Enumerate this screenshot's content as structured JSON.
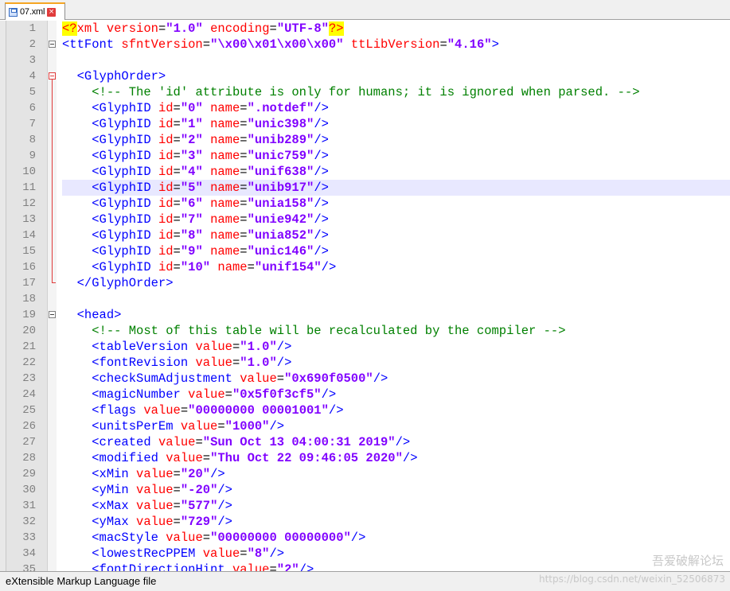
{
  "tab": {
    "label": "07.xml",
    "close": "×"
  },
  "status": {
    "file_type": "eXtensible Markup Language file"
  },
  "watermark": {
    "site": "吾爱破解论坛",
    "url": "https://blog.csdn.net/weixin_52506873"
  },
  "current_line": 11,
  "lines": [
    {
      "n": "1",
      "fold": "none",
      "parts": [
        [
          "pi",
          "<?"
        ],
        [
          "pibody",
          "xml "
        ],
        [
          "attr",
          "version"
        ],
        [
          "plain",
          "="
        ],
        [
          "val",
          "\"1.0\""
        ],
        [
          "plain",
          " "
        ],
        [
          "attr",
          "encoding"
        ],
        [
          "plain",
          "="
        ],
        [
          "val",
          "\"UTF-8\""
        ],
        [
          "pi",
          "?>"
        ]
      ]
    },
    {
      "n": "2",
      "fold": "open-grey",
      "parts": [
        [
          "tag",
          "<ttFont "
        ],
        [
          "attr",
          "sfntVersion"
        ],
        [
          "plain",
          "="
        ],
        [
          "val",
          "\"\\x00\\x01\\x00\\x00\""
        ],
        [
          "plain",
          " "
        ],
        [
          "attr",
          "ttLibVersion"
        ],
        [
          "plain",
          "="
        ],
        [
          "val",
          "\"4.16\""
        ],
        [
          "tag",
          ">"
        ]
      ]
    },
    {
      "n": "3",
      "fold": "none",
      "parts": []
    },
    {
      "n": "4",
      "fold": "open-red",
      "parts": [
        [
          "plain",
          "  "
        ],
        [
          "tag",
          "<GlyphOrder>"
        ]
      ]
    },
    {
      "n": "5",
      "fold": "line",
      "parts": [
        [
          "plain",
          "    "
        ],
        [
          "com",
          "<!-- The 'id' attribute is only for humans; it is ignored when parsed. -->"
        ]
      ]
    },
    {
      "n": "6",
      "fold": "line",
      "parts": [
        [
          "plain",
          "    "
        ],
        [
          "tag",
          "<GlyphID "
        ],
        [
          "attr",
          "id"
        ],
        [
          "plain",
          "="
        ],
        [
          "val",
          "\"0\""
        ],
        [
          "plain",
          " "
        ],
        [
          "attr",
          "name"
        ],
        [
          "plain",
          "="
        ],
        [
          "val",
          "\".notdef\""
        ],
        [
          "tag",
          "/>"
        ]
      ]
    },
    {
      "n": "7",
      "fold": "line",
      "parts": [
        [
          "plain",
          "    "
        ],
        [
          "tag",
          "<GlyphID "
        ],
        [
          "attr",
          "id"
        ],
        [
          "plain",
          "="
        ],
        [
          "val",
          "\"1\""
        ],
        [
          "plain",
          " "
        ],
        [
          "attr",
          "name"
        ],
        [
          "plain",
          "="
        ],
        [
          "val",
          "\"unic398\""
        ],
        [
          "tag",
          "/>"
        ]
      ]
    },
    {
      "n": "8",
      "fold": "line",
      "parts": [
        [
          "plain",
          "    "
        ],
        [
          "tag",
          "<GlyphID "
        ],
        [
          "attr",
          "id"
        ],
        [
          "plain",
          "="
        ],
        [
          "val",
          "\"2\""
        ],
        [
          "plain",
          " "
        ],
        [
          "attr",
          "name"
        ],
        [
          "plain",
          "="
        ],
        [
          "val",
          "\"unib289\""
        ],
        [
          "tag",
          "/>"
        ]
      ]
    },
    {
      "n": "9",
      "fold": "line",
      "parts": [
        [
          "plain",
          "    "
        ],
        [
          "tag",
          "<GlyphID "
        ],
        [
          "attr",
          "id"
        ],
        [
          "plain",
          "="
        ],
        [
          "val",
          "\"3\""
        ],
        [
          "plain",
          " "
        ],
        [
          "attr",
          "name"
        ],
        [
          "plain",
          "="
        ],
        [
          "val",
          "\"unic759\""
        ],
        [
          "tag",
          "/>"
        ]
      ]
    },
    {
      "n": "10",
      "fold": "line",
      "parts": [
        [
          "plain",
          "    "
        ],
        [
          "tag",
          "<GlyphID "
        ],
        [
          "attr",
          "id"
        ],
        [
          "plain",
          "="
        ],
        [
          "val",
          "\"4\""
        ],
        [
          "plain",
          " "
        ],
        [
          "attr",
          "name"
        ],
        [
          "plain",
          "="
        ],
        [
          "val",
          "\"unif638\""
        ],
        [
          "tag",
          "/>"
        ]
      ]
    },
    {
      "n": "11",
      "fold": "line",
      "parts": [
        [
          "plain",
          "    "
        ],
        [
          "tag",
          "<GlyphID "
        ],
        [
          "attr",
          "id"
        ],
        [
          "plain",
          "="
        ],
        [
          "val",
          "\"5\""
        ],
        [
          "plain",
          " "
        ],
        [
          "attr",
          "name"
        ],
        [
          "plain",
          "="
        ],
        [
          "val",
          "\"unib917\""
        ],
        [
          "tag",
          "/>"
        ]
      ]
    },
    {
      "n": "12",
      "fold": "line",
      "parts": [
        [
          "plain",
          "    "
        ],
        [
          "tag",
          "<GlyphID "
        ],
        [
          "attr",
          "id"
        ],
        [
          "plain",
          "="
        ],
        [
          "val",
          "\"6\""
        ],
        [
          "plain",
          " "
        ],
        [
          "attr",
          "name"
        ],
        [
          "plain",
          "="
        ],
        [
          "val",
          "\"unia158\""
        ],
        [
          "tag",
          "/>"
        ]
      ]
    },
    {
      "n": "13",
      "fold": "line",
      "parts": [
        [
          "plain",
          "    "
        ],
        [
          "tag",
          "<GlyphID "
        ],
        [
          "attr",
          "id"
        ],
        [
          "plain",
          "="
        ],
        [
          "val",
          "\"7\""
        ],
        [
          "plain",
          " "
        ],
        [
          "attr",
          "name"
        ],
        [
          "plain",
          "="
        ],
        [
          "val",
          "\"unie942\""
        ],
        [
          "tag",
          "/>"
        ]
      ]
    },
    {
      "n": "14",
      "fold": "line",
      "parts": [
        [
          "plain",
          "    "
        ],
        [
          "tag",
          "<GlyphID "
        ],
        [
          "attr",
          "id"
        ],
        [
          "plain",
          "="
        ],
        [
          "val",
          "\"8\""
        ],
        [
          "plain",
          " "
        ],
        [
          "attr",
          "name"
        ],
        [
          "plain",
          "="
        ],
        [
          "val",
          "\"unia852\""
        ],
        [
          "tag",
          "/>"
        ]
      ]
    },
    {
      "n": "15",
      "fold": "line",
      "parts": [
        [
          "plain",
          "    "
        ],
        [
          "tag",
          "<GlyphID "
        ],
        [
          "attr",
          "id"
        ],
        [
          "plain",
          "="
        ],
        [
          "val",
          "\"9\""
        ],
        [
          "plain",
          " "
        ],
        [
          "attr",
          "name"
        ],
        [
          "plain",
          "="
        ],
        [
          "val",
          "\"unic146\""
        ],
        [
          "tag",
          "/>"
        ]
      ]
    },
    {
      "n": "16",
      "fold": "line",
      "parts": [
        [
          "plain",
          "    "
        ],
        [
          "tag",
          "<GlyphID "
        ],
        [
          "attr",
          "id"
        ],
        [
          "plain",
          "="
        ],
        [
          "val",
          "\"10\""
        ],
        [
          "plain",
          " "
        ],
        [
          "attr",
          "name"
        ],
        [
          "plain",
          "="
        ],
        [
          "val",
          "\"unif154\""
        ],
        [
          "tag",
          "/>"
        ]
      ]
    },
    {
      "n": "17",
      "fold": "end",
      "parts": [
        [
          "plain",
          "  "
        ],
        [
          "tag",
          "</GlyphOrder>"
        ]
      ]
    },
    {
      "n": "18",
      "fold": "none",
      "parts": []
    },
    {
      "n": "19",
      "fold": "open-grey",
      "parts": [
        [
          "plain",
          "  "
        ],
        [
          "tag",
          "<head>"
        ]
      ]
    },
    {
      "n": "20",
      "fold": "none",
      "parts": [
        [
          "plain",
          "    "
        ],
        [
          "com",
          "<!-- Most of this table will be recalculated by the compiler -->"
        ]
      ]
    },
    {
      "n": "21",
      "fold": "none",
      "parts": [
        [
          "plain",
          "    "
        ],
        [
          "tag",
          "<tableVersion "
        ],
        [
          "attr",
          "value"
        ],
        [
          "plain",
          "="
        ],
        [
          "val",
          "\"1.0\""
        ],
        [
          "tag",
          "/>"
        ]
      ]
    },
    {
      "n": "22",
      "fold": "none",
      "parts": [
        [
          "plain",
          "    "
        ],
        [
          "tag",
          "<fontRevision "
        ],
        [
          "attr",
          "value"
        ],
        [
          "plain",
          "="
        ],
        [
          "val",
          "\"1.0\""
        ],
        [
          "tag",
          "/>"
        ]
      ]
    },
    {
      "n": "23",
      "fold": "none",
      "parts": [
        [
          "plain",
          "    "
        ],
        [
          "tag",
          "<checkSumAdjustment "
        ],
        [
          "attr",
          "value"
        ],
        [
          "plain",
          "="
        ],
        [
          "val",
          "\"0x690f0500\""
        ],
        [
          "tag",
          "/>"
        ]
      ]
    },
    {
      "n": "24",
      "fold": "none",
      "parts": [
        [
          "plain",
          "    "
        ],
        [
          "tag",
          "<magicNumber "
        ],
        [
          "attr",
          "value"
        ],
        [
          "plain",
          "="
        ],
        [
          "val",
          "\"0x5f0f3cf5\""
        ],
        [
          "tag",
          "/>"
        ]
      ]
    },
    {
      "n": "25",
      "fold": "none",
      "parts": [
        [
          "plain",
          "    "
        ],
        [
          "tag",
          "<flags "
        ],
        [
          "attr",
          "value"
        ],
        [
          "plain",
          "="
        ],
        [
          "val",
          "\"00000000 00001001\""
        ],
        [
          "tag",
          "/>"
        ]
      ]
    },
    {
      "n": "26",
      "fold": "none",
      "parts": [
        [
          "plain",
          "    "
        ],
        [
          "tag",
          "<unitsPerEm "
        ],
        [
          "attr",
          "value"
        ],
        [
          "plain",
          "="
        ],
        [
          "val",
          "\"1000\""
        ],
        [
          "tag",
          "/>"
        ]
      ]
    },
    {
      "n": "27",
      "fold": "none",
      "parts": [
        [
          "plain",
          "    "
        ],
        [
          "tag",
          "<created "
        ],
        [
          "attr",
          "value"
        ],
        [
          "plain",
          "="
        ],
        [
          "val",
          "\"Sun Oct 13 04:00:31 2019\""
        ],
        [
          "tag",
          "/>"
        ]
      ]
    },
    {
      "n": "28",
      "fold": "none",
      "parts": [
        [
          "plain",
          "    "
        ],
        [
          "tag",
          "<modified "
        ],
        [
          "attr",
          "value"
        ],
        [
          "plain",
          "="
        ],
        [
          "val",
          "\"Thu Oct 22 09:46:05 2020\""
        ],
        [
          "tag",
          "/>"
        ]
      ]
    },
    {
      "n": "29",
      "fold": "none",
      "parts": [
        [
          "plain",
          "    "
        ],
        [
          "tag",
          "<xMin "
        ],
        [
          "attr",
          "value"
        ],
        [
          "plain",
          "="
        ],
        [
          "val",
          "\"20\""
        ],
        [
          "tag",
          "/>"
        ]
      ]
    },
    {
      "n": "30",
      "fold": "none",
      "parts": [
        [
          "plain",
          "    "
        ],
        [
          "tag",
          "<yMin "
        ],
        [
          "attr",
          "value"
        ],
        [
          "plain",
          "="
        ],
        [
          "val",
          "\"-20\""
        ],
        [
          "tag",
          "/>"
        ]
      ]
    },
    {
      "n": "31",
      "fold": "none",
      "parts": [
        [
          "plain",
          "    "
        ],
        [
          "tag",
          "<xMax "
        ],
        [
          "attr",
          "value"
        ],
        [
          "plain",
          "="
        ],
        [
          "val",
          "\"577\""
        ],
        [
          "tag",
          "/>"
        ]
      ]
    },
    {
      "n": "32",
      "fold": "none",
      "parts": [
        [
          "plain",
          "    "
        ],
        [
          "tag",
          "<yMax "
        ],
        [
          "attr",
          "value"
        ],
        [
          "plain",
          "="
        ],
        [
          "val",
          "\"729\""
        ],
        [
          "tag",
          "/>"
        ]
      ]
    },
    {
      "n": "33",
      "fold": "none",
      "parts": [
        [
          "plain",
          "    "
        ],
        [
          "tag",
          "<macStyle "
        ],
        [
          "attr",
          "value"
        ],
        [
          "plain",
          "="
        ],
        [
          "val",
          "\"00000000 00000000\""
        ],
        [
          "tag",
          "/>"
        ]
      ]
    },
    {
      "n": "34",
      "fold": "none",
      "parts": [
        [
          "plain",
          "    "
        ],
        [
          "tag",
          "<lowestRecPPEM "
        ],
        [
          "attr",
          "value"
        ],
        [
          "plain",
          "="
        ],
        [
          "val",
          "\"8\""
        ],
        [
          "tag",
          "/>"
        ]
      ]
    },
    {
      "n": "35",
      "fold": "none",
      "parts": [
        [
          "plain",
          "    "
        ],
        [
          "tag",
          "<fontDirectionHint "
        ],
        [
          "attr",
          "value"
        ],
        [
          "plain",
          "="
        ],
        [
          "val",
          "\"2\""
        ],
        [
          "tag",
          "/>"
        ]
      ]
    }
  ]
}
